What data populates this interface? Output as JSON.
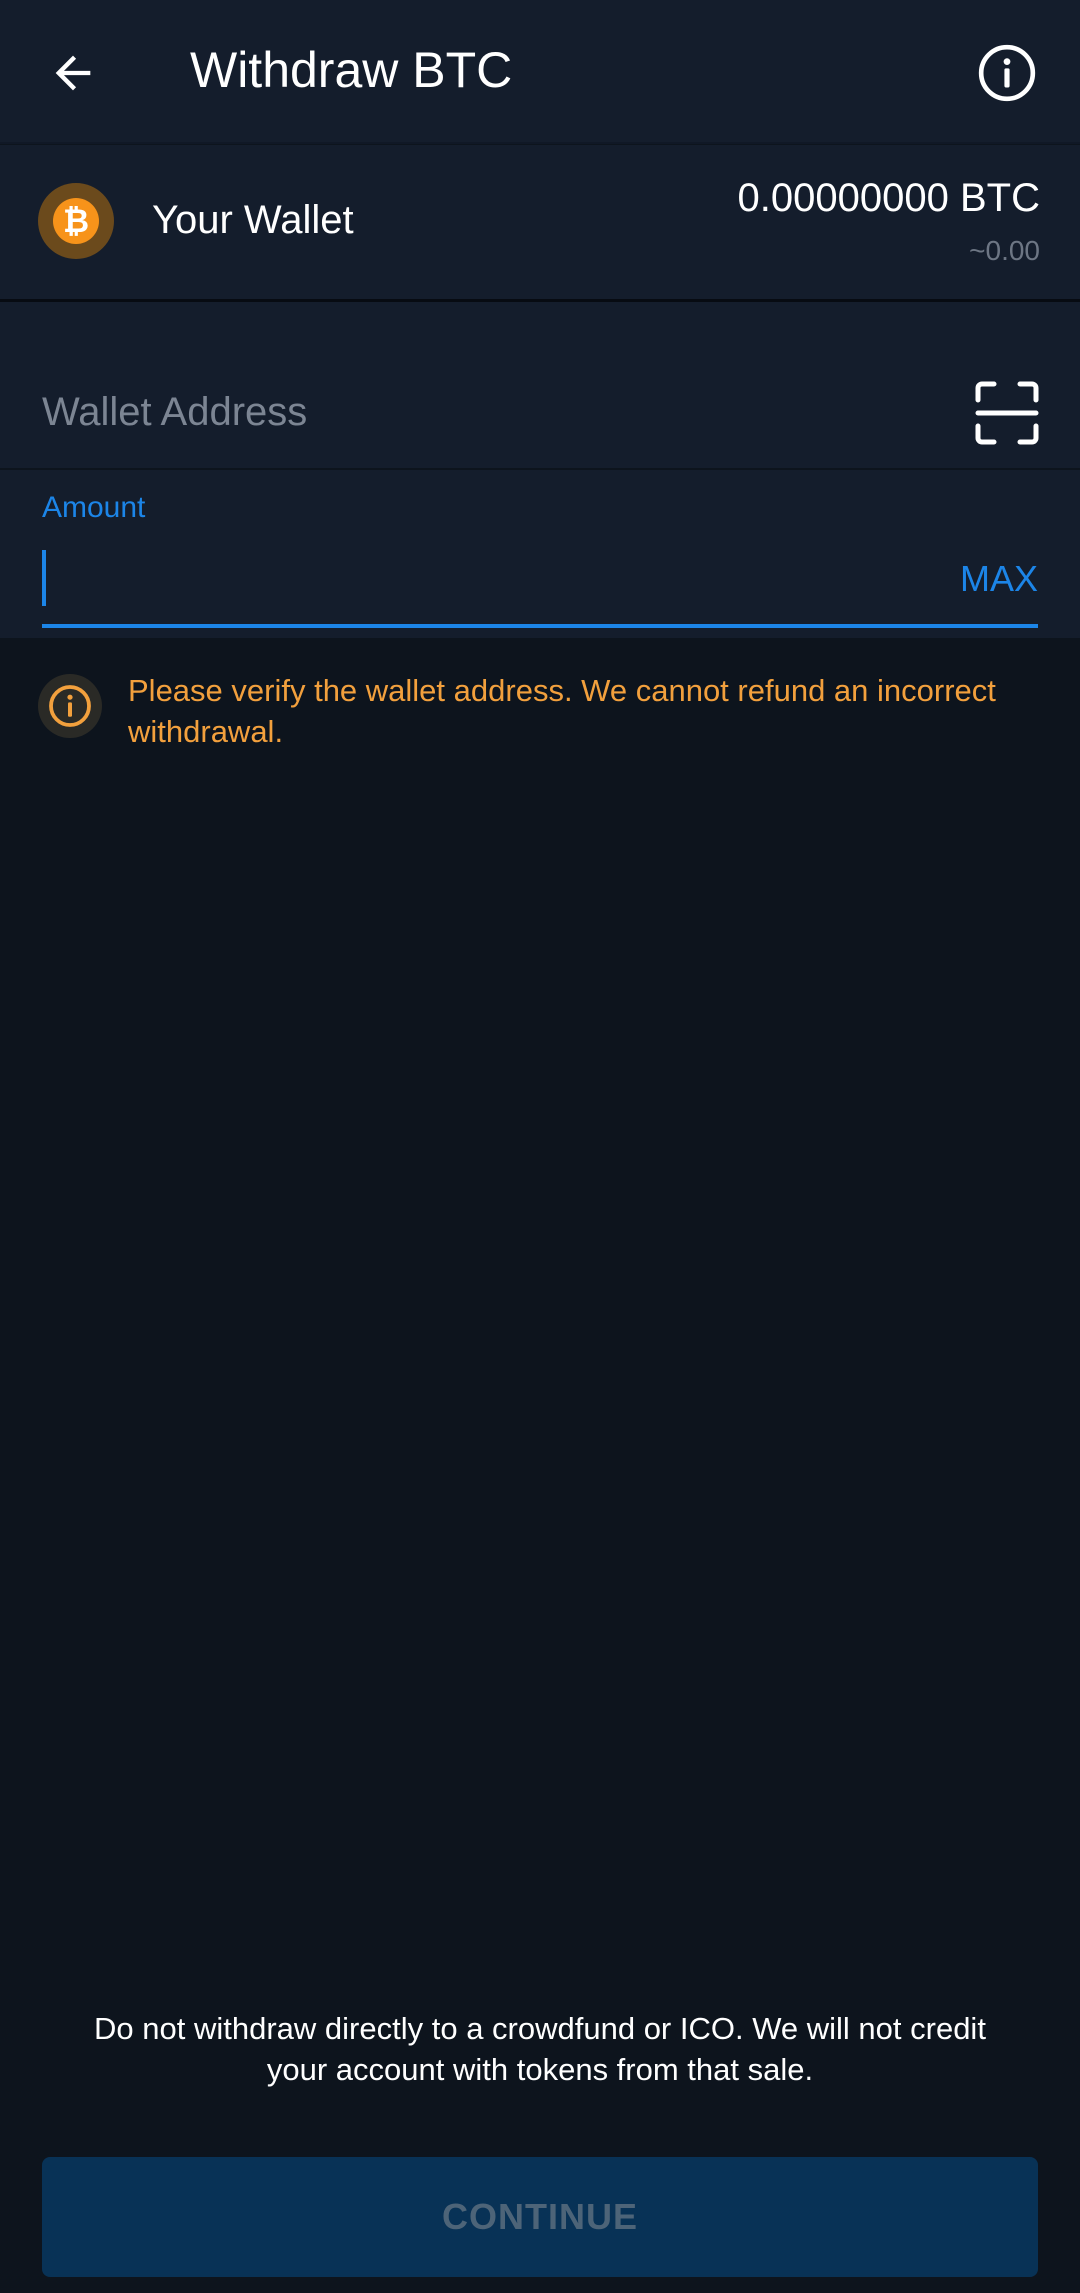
{
  "header": {
    "title": "Withdraw BTC",
    "back_icon": "arrow-left-icon",
    "info_icon": "info-circle-icon"
  },
  "wallet": {
    "icon": "bitcoin-icon",
    "icon_symbol": "₿",
    "label": "Your Wallet",
    "balance": "0.00000000 BTC",
    "fiat_value": "~0.00"
  },
  "address": {
    "placeholder": "Wallet Address",
    "value": "",
    "scan_icon": "qr-scan-icon"
  },
  "amount": {
    "label": "Amount",
    "value": "",
    "max_label": "MAX"
  },
  "warning": {
    "icon": "info-circle-icon",
    "text": "Please verify the wallet address. We cannot refund an incorrect withdrawal."
  },
  "disclaimer": "Do not withdraw directly to a crowdfund or ICO. We will not credit your account with tokens from that sale.",
  "continue_label": "CONTINUE",
  "colors": {
    "accent": "#1c85e8",
    "warning": "#f2a03d",
    "bitcoin": "#f7931a",
    "background": "#0d141d",
    "surface": "#141d2c",
    "button_disabled": "#083256"
  }
}
